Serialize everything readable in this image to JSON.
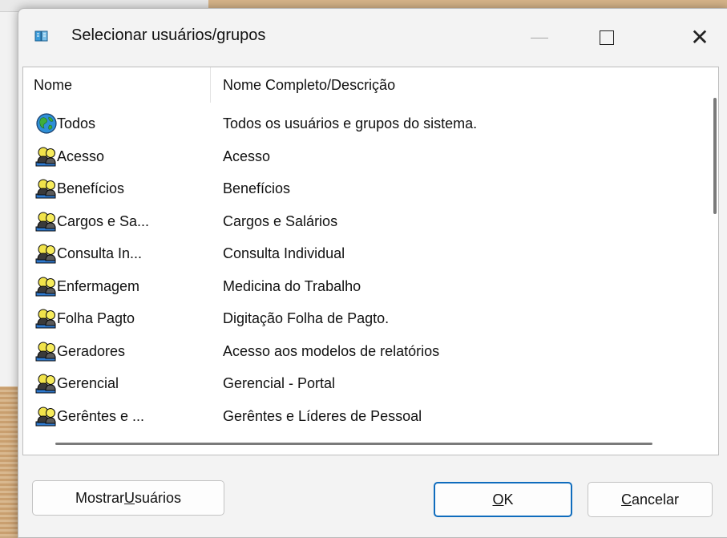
{
  "dialog": {
    "title": "Selecionar usuários/grupos",
    "icon": "app-icon"
  },
  "titlebar_buttons": {
    "minimize_icon": "minimize-icon",
    "maximize_icon": "maximize-icon",
    "close_icon": "close-icon",
    "close_glyph": "✕"
  },
  "list": {
    "columns": {
      "name": "Nome",
      "description": "Nome Completo/Descrição"
    },
    "rows": [
      {
        "name": "Todos",
        "description": "Todos os usuários e grupos do sistema.",
        "icon": "globe-icon"
      },
      {
        "name": "Acesso",
        "description": "Acesso",
        "icon": "group-icon"
      },
      {
        "name": "Benefícios",
        "description": "Benefícios",
        "icon": "group-icon"
      },
      {
        "name": "Cargos e Sa...",
        "description": "Cargos e Salários",
        "icon": "group-icon"
      },
      {
        "name": "Consulta In...",
        "description": "Consulta Individual",
        "icon": "group-icon"
      },
      {
        "name": "Enfermagem",
        "description": "Medicina do Trabalho",
        "icon": "group-icon"
      },
      {
        "name": "Folha Pagto",
        "description": "Digitação Folha de Pagto.",
        "icon": "group-icon"
      },
      {
        "name": "Geradores",
        "description": "Acesso aos modelos de relatórios",
        "icon": "group-icon"
      },
      {
        "name": "Gerencial",
        "description": "Gerencial - Portal",
        "icon": "group-icon"
      },
      {
        "name": "Gerêntes e ...",
        "description": "Gerêntes e Líderes de Pessoal",
        "icon": "group-icon"
      }
    ]
  },
  "buttons": {
    "show_users": {
      "before": "Mostrar ",
      "accel": "U",
      "after": "suários"
    },
    "ok": {
      "accel": "O",
      "after": "K"
    },
    "cancel": {
      "accel": "C",
      "after": "ancelar"
    }
  },
  "colors": {
    "accent": "#0f6cbd",
    "dialog_bg": "#f3f3f3",
    "list_bg": "#ffffff"
  }
}
